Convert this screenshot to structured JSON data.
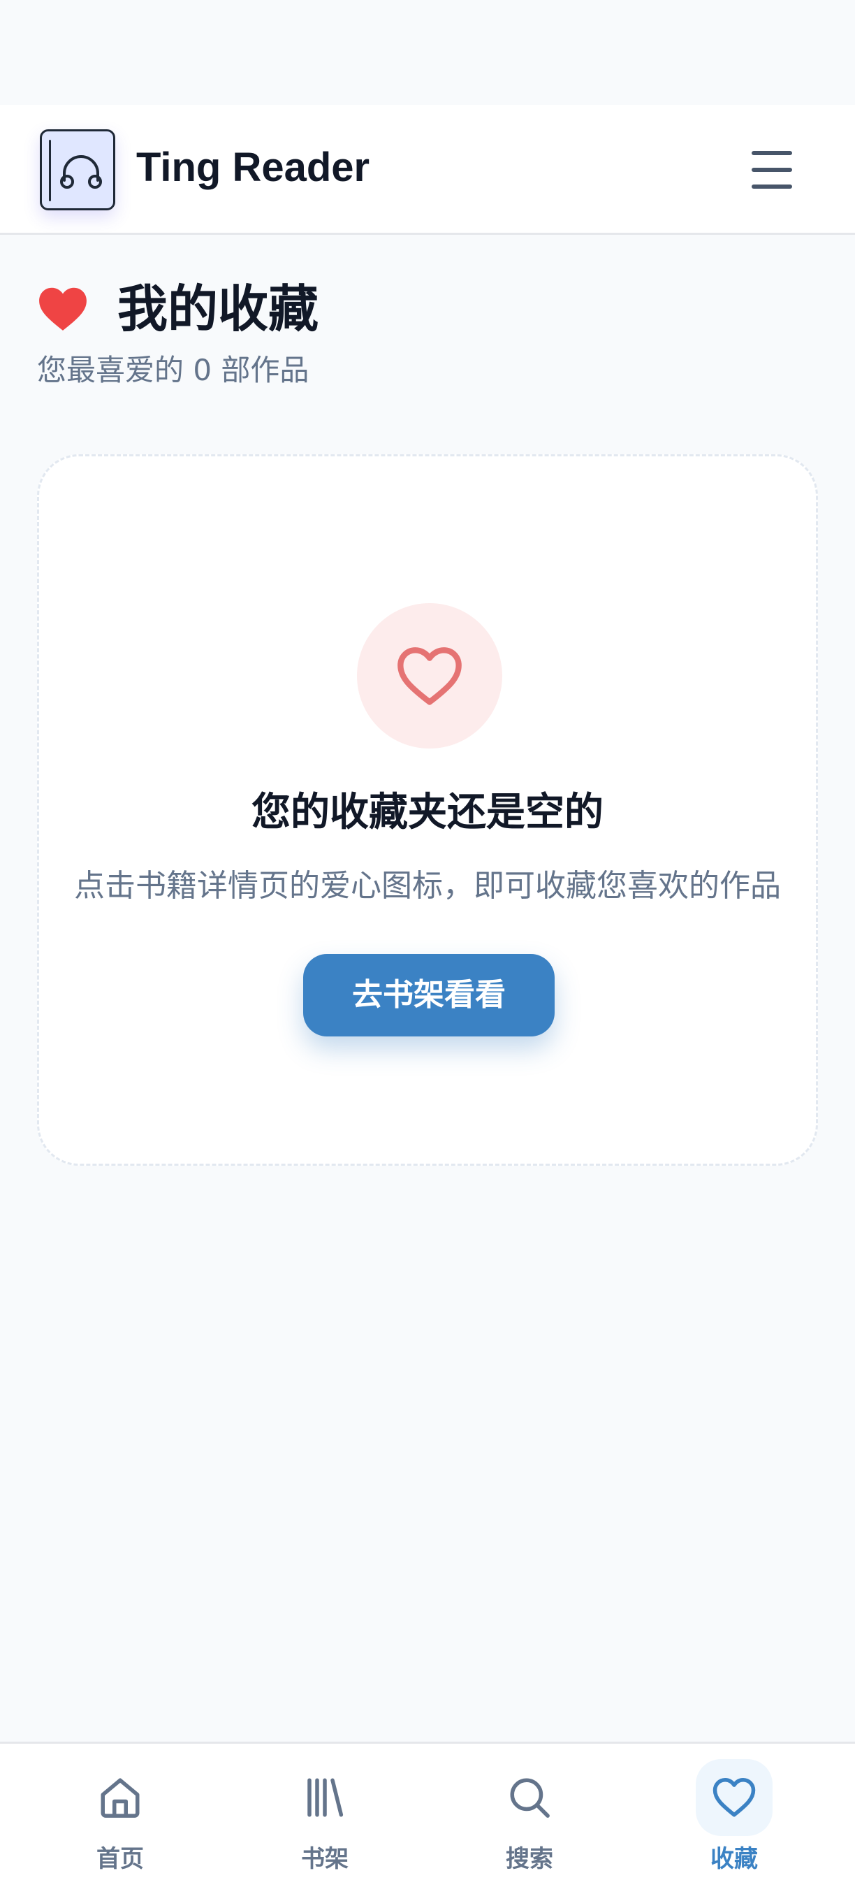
{
  "header": {
    "app_title": "Ting Reader",
    "logo_icon": "headphones-book-icon",
    "menu_icon": "hamburger-menu-icon"
  },
  "favorites": {
    "title": "我的收藏",
    "subtitle": "您最喜爱的 0 部作品",
    "title_icon": "heart-icon",
    "heart_color": "#ef4444"
  },
  "empty_state": {
    "icon": "heart-outline-icon",
    "title": "您的收藏夹还是空的",
    "description": "点击书籍详情页的爱心图标，即可收藏您喜欢的作品",
    "button_label": "去书架看看"
  },
  "bottom_nav": {
    "items": [
      {
        "label": "首页",
        "icon": "home-icon",
        "active": false
      },
      {
        "label": "书架",
        "icon": "library-icon",
        "active": false
      },
      {
        "label": "搜索",
        "icon": "search-icon",
        "active": false
      },
      {
        "label": "收藏",
        "icon": "heart-icon",
        "active": true
      }
    ]
  },
  "colors": {
    "accent": "#3b82c4",
    "heart": "#ef4444",
    "text_primary": "#111827",
    "text_secondary": "#64748b",
    "background": "#f8fafc"
  }
}
